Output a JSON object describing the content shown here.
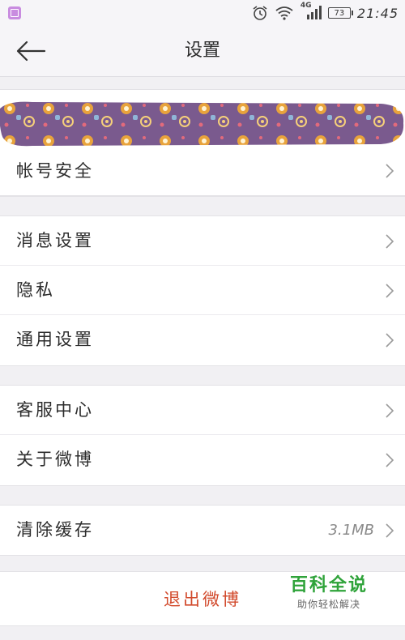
{
  "status_bar": {
    "network": "4G",
    "battery": "73",
    "time": "21:45",
    "icons": [
      "gallery-icon",
      "alarm-icon",
      "wifi-icon",
      "signal-icon",
      "battery-icon"
    ]
  },
  "header": {
    "title": "设置",
    "back_icon": "back-arrow-icon"
  },
  "account_group": {
    "items": [
      {
        "label": "帐号安全"
      }
    ]
  },
  "notify_group": {
    "items": [
      {
        "label": "消息设置"
      },
      {
        "label": "隐私"
      },
      {
        "label": "通用设置"
      }
    ]
  },
  "support_group": {
    "items": [
      {
        "label": "客服中心"
      },
      {
        "label": "关于微博"
      }
    ]
  },
  "cache_group": {
    "items": [
      {
        "label": "清除缓存",
        "value": "3.1MB"
      }
    ]
  },
  "logout": {
    "label": "退出微博",
    "color": "#d24a2c"
  },
  "watermark": {
    "title": "百科全说",
    "subtitle": "助你轻松解决"
  },
  "colors": {
    "banner": "#7a5a8e",
    "accent": "#d24a2c",
    "watermark": "#2fa33a"
  }
}
